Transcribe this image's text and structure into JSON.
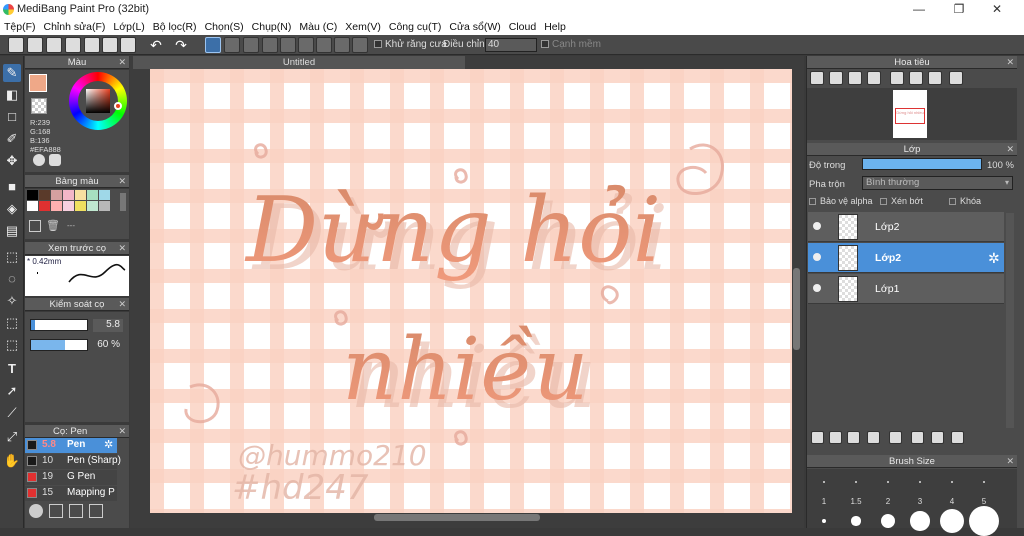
{
  "window": {
    "title": "MediBang Paint Pro (32bit)",
    "controls": [
      "—",
      "❐",
      "✕"
    ]
  },
  "menu": [
    "Tệp(F)",
    "Chỉnh sửa(F)",
    "Lớp(L)",
    "Bộ lọc(R)",
    "Chọn(S)",
    "Chụp(N)",
    "Màu (C)",
    "Xem(V)",
    "Công cụ(T)",
    "Cửa sổ(W)",
    "Cloud",
    "Help"
  ],
  "toolbar": {
    "antialias_label": "Khử răng cưa",
    "adjust_label": "Điều chỉnh",
    "adjust_value": "40",
    "smooth_label": "Cạnh mềm"
  },
  "color_panel": {
    "title": "Màu",
    "r": "R:239",
    "g": "G:168",
    "b": "B:136",
    "hex": "#EFA888",
    "primary_color": "#EFA888"
  },
  "palette_panel": {
    "title": "Bảng màu",
    "swatches": [
      "#000000",
      "#5a3a2a",
      "#d4a0a0",
      "#f3b6c8",
      "#f7e0a0",
      "#a7e0c0",
      "#9fd8e8",
      "#ffffff",
      "#e03030",
      "#ffb0b0",
      "#f8d0e0",
      "#f0e060",
      "#c0e8d0",
      "#b8b8b8"
    ],
    "more": "---"
  },
  "preview_panel": {
    "title": "Xem trước cọ",
    "size": "* 0.42mm"
  },
  "brush_control_panel": {
    "title": "Kiểm soát cọ",
    "size_value": "5.8",
    "size_fraction": 0.07,
    "opacity_value": "60 %",
    "opacity_fraction": 0.6
  },
  "brush_panel": {
    "title": "Cọ: Pen",
    "items": [
      {
        "size": "5.8",
        "name": "Pen",
        "color": "#1a1a1a"
      },
      {
        "size": "10",
        "name": "Pen (Sharp)",
        "color": "#1a1a1a"
      },
      {
        "size": "19",
        "name": "G Pen",
        "color": "#e03030"
      },
      {
        "size": "15",
        "name": "Mapping P",
        "color": "#e03030"
      }
    ]
  },
  "canvas": {
    "tab": "Untitled",
    "art_line1": "Dừng hỏi",
    "art_line2": "nhiều",
    "signature1": "@hummo210",
    "signature2": "#hd247"
  },
  "navigator_panel": {
    "title": "Hoa tiêu",
    "thumb_text": "Dừng hỏi nhiều"
  },
  "layer_panel": {
    "title": "Lớp",
    "opacity_label": "Độ trong",
    "opacity_value": "100 %",
    "opacity_fraction": 1.0,
    "blend_label": "Pha trộn",
    "blend_value": "Bình thường",
    "protect_alpha": "Bảo vệ alpha",
    "clipping": "Xén bớt",
    "lock": "Khóa",
    "layers": [
      {
        "name": "Lớp2",
        "selected": false
      },
      {
        "name": "Lớp2",
        "selected": true
      },
      {
        "name": "Lớp1",
        "selected": false
      }
    ]
  },
  "brush_size_panel": {
    "title": "Brush Size",
    "sizes": [
      "1",
      "1.5",
      "2",
      "3",
      "4",
      "5"
    ]
  }
}
